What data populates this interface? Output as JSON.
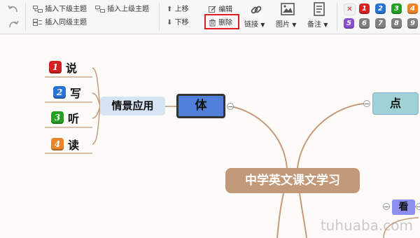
{
  "toolbar": {
    "insert_child": "插入下级主题",
    "insert_parent": "插入上级主题",
    "insert_sibling": "插入同级主题",
    "move_up": "上移",
    "move_down": "下移",
    "edit": "编辑",
    "delete": "删除",
    "link": "链接",
    "image": "图片",
    "note": "备注",
    "priorities_row1": [
      "1",
      "2",
      "3",
      "4"
    ],
    "priorities_row2": [
      "5",
      "6",
      "7",
      "8",
      "9"
    ],
    "icons": [
      "undo-icon",
      "redo-icon",
      "link-icon",
      "image-icon",
      "note-icon",
      "trash-icon",
      "edit-icon"
    ]
  },
  "mindmap": {
    "root": "中学英文课文学习",
    "nodes": {
      "ti": "体",
      "dian": "点",
      "kan": "看",
      "scene": "情景应用"
    },
    "leaves": [
      {
        "num": "1",
        "label": "说",
        "color": "#d42020"
      },
      {
        "num": "2",
        "label": "写",
        "color": "#2a72d0"
      },
      {
        "num": "3",
        "label": "听",
        "color": "#22a022"
      },
      {
        "num": "4",
        "label": "读",
        "color": "#e8852a"
      }
    ]
  },
  "watermark": "tuhuaba.com",
  "colors": {
    "root": "#c39a79",
    "ti": "#4f7fd8",
    "dian": "#9fd2d6",
    "kan": "#8d8fee",
    "scene": "#d6e4f3",
    "delete_highlight": "#e02020"
  }
}
